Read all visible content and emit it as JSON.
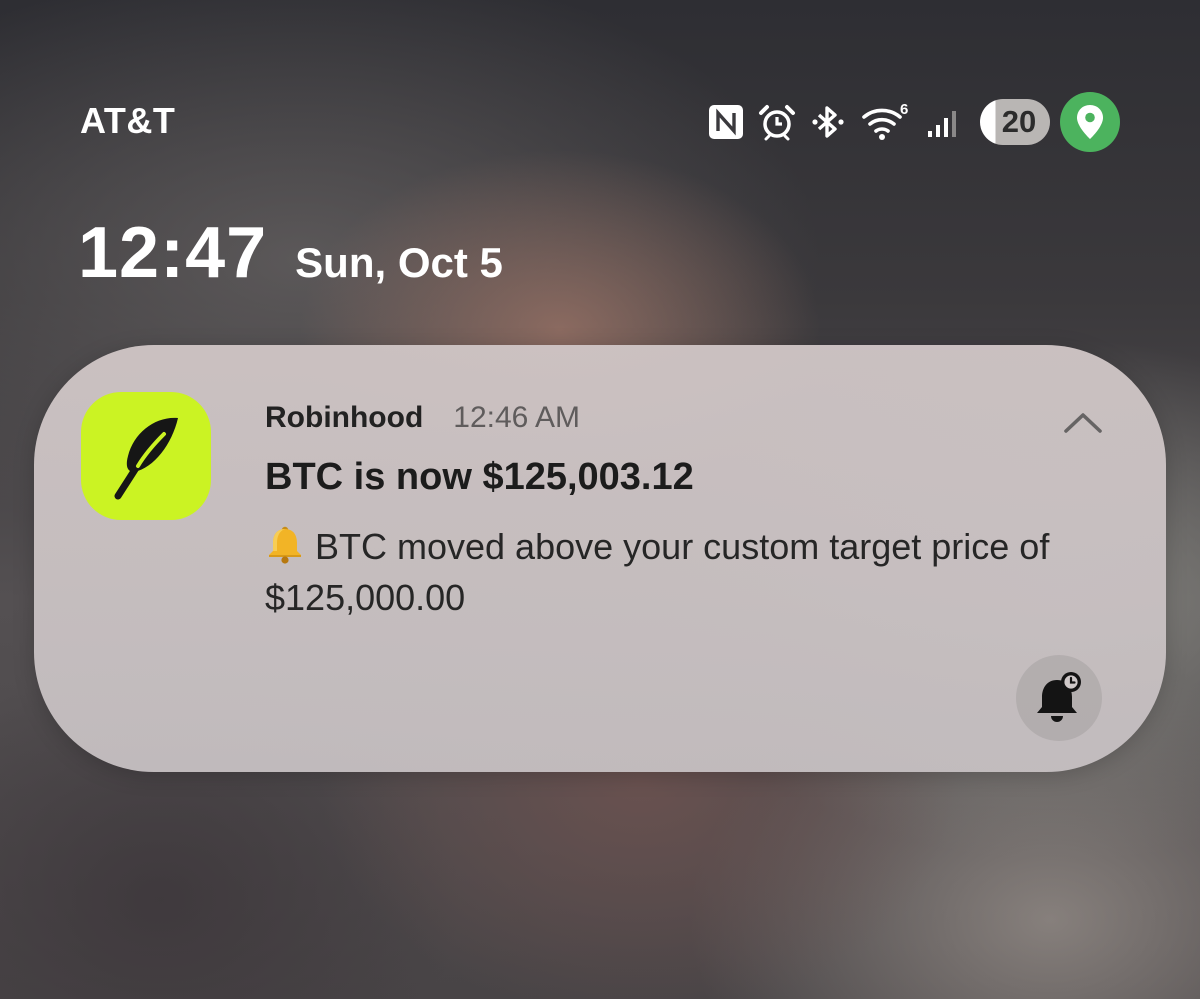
{
  "status_bar": {
    "carrier": "AT&T",
    "icons": [
      "nfc-icon",
      "alarm-icon",
      "bluetooth-icon",
      "wifi-icon",
      "signal-icon"
    ],
    "wifi_generation": "6",
    "battery_level": "20",
    "location_active_color": "#4cb35e"
  },
  "lock_clock": {
    "time": "12:47",
    "date": "Sun, Oct 5"
  },
  "notification": {
    "app_name": "Robinhood",
    "app_icon": "robinhood-feather-icon",
    "app_icon_color": "#cbf323",
    "time": "12:46 AM",
    "title": "BTC is now $125,003.12",
    "body_emoji": "bell-emoji",
    "body": "BTC moved above your custom target price of $125,000.00",
    "actions": [
      "collapse-chevron-icon",
      "snooze-bell-icon"
    ]
  }
}
